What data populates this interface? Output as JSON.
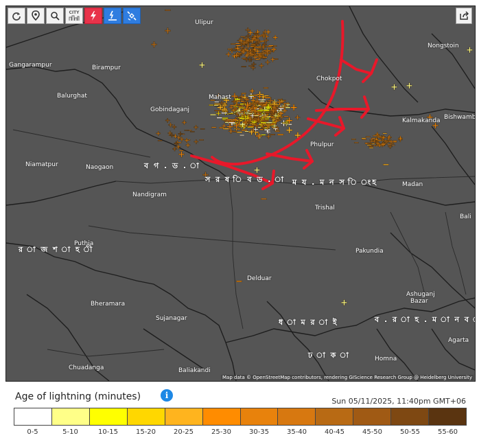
{
  "toolbar": {
    "buttons": [
      {
        "icon": "refresh-icon"
      },
      {
        "icon": "location-pin-icon"
      },
      {
        "icon": "zoom-icon"
      },
      {
        "icon": "city-icon",
        "label": "CITY"
      },
      {
        "icon": "lightning-icon"
      },
      {
        "icon": "detector-icon"
      },
      {
        "icon": "satellite-icon"
      }
    ],
    "share_icon": "share-icon"
  },
  "places": {
    "ulipur": "Ulipur",
    "gangarampur": "Gangarampur",
    "birampur": "Birampur",
    "balurghat": "Balurghat",
    "gobindaganj": "Gobindaganj",
    "mahasthan": "Mahast",
    "chokpot": "Chokpot",
    "nongstoin": "Nongstoin",
    "kalmakanda": "Kalmakanda",
    "bishwamb": "Bishwamb",
    "niamatpur": "Niamatpur",
    "naogaon": "Naogaon",
    "bogura": "ব গ . ড . া",
    "sherpur": "স র ষ ি ব ড . া",
    "phulpur": "Phulpur",
    "mymensingh": "ম য . ম ন স ি ংহ",
    "madan": "Madan",
    "bali": "Bali",
    "nandigram": "Nandigram",
    "trishal": "Trishal",
    "rajshahi": "র া জ শ া হ ী",
    "puthia": "Puthia",
    "pakundia": "Pakundia",
    "delduar": "Delduar",
    "bheramara": "Bheramara",
    "ashuganj": "Ashuganj",
    "bazar": "Bazar",
    "sujanagar": "Sujanagar",
    "dhaka_div": "ধ া ম র া ই",
    "brahmanbaria": "ব . র া হ . ম া ন ব া ড . ি",
    "agartala": "Agarta",
    "dhaka": "ঢ া ক া",
    "homna": "Homna",
    "chuadanga": "Chuadanga",
    "baliakandi": "Baliakandi"
  },
  "attribution": "Map data © OpenStreetMap contributors, rendering GIScience Research Group @ Heidelberg University",
  "legend": {
    "title": "Age of lightning (minutes)",
    "info_icon": "info-icon",
    "timestamp": "Sun 05/11/2025, 11:40pm GMT+06",
    "bins": [
      {
        "label": "0-5",
        "color": "#ffffff"
      },
      {
        "label": "5-10",
        "color": "#ffff88"
      },
      {
        "label": "10-15",
        "color": "#ffff00"
      },
      {
        "label": "15-20",
        "color": "#ffd700"
      },
      {
        "label": "20-25",
        "color": "#ffb41e"
      },
      {
        "label": "25-30",
        "color": "#ff8c00"
      },
      {
        "label": "30-35",
        "color": "#e8820c"
      },
      {
        "label": "35-40",
        "color": "#d77810"
      },
      {
        "label": "40-45",
        "color": "#b86a14"
      },
      {
        "label": "45-50",
        "color": "#a05a14"
      },
      {
        "label": "50-55",
        "color": "#7e4812"
      },
      {
        "label": "55-60",
        "color": "#5a3410"
      }
    ]
  },
  "annotation_color": "#e8182a"
}
